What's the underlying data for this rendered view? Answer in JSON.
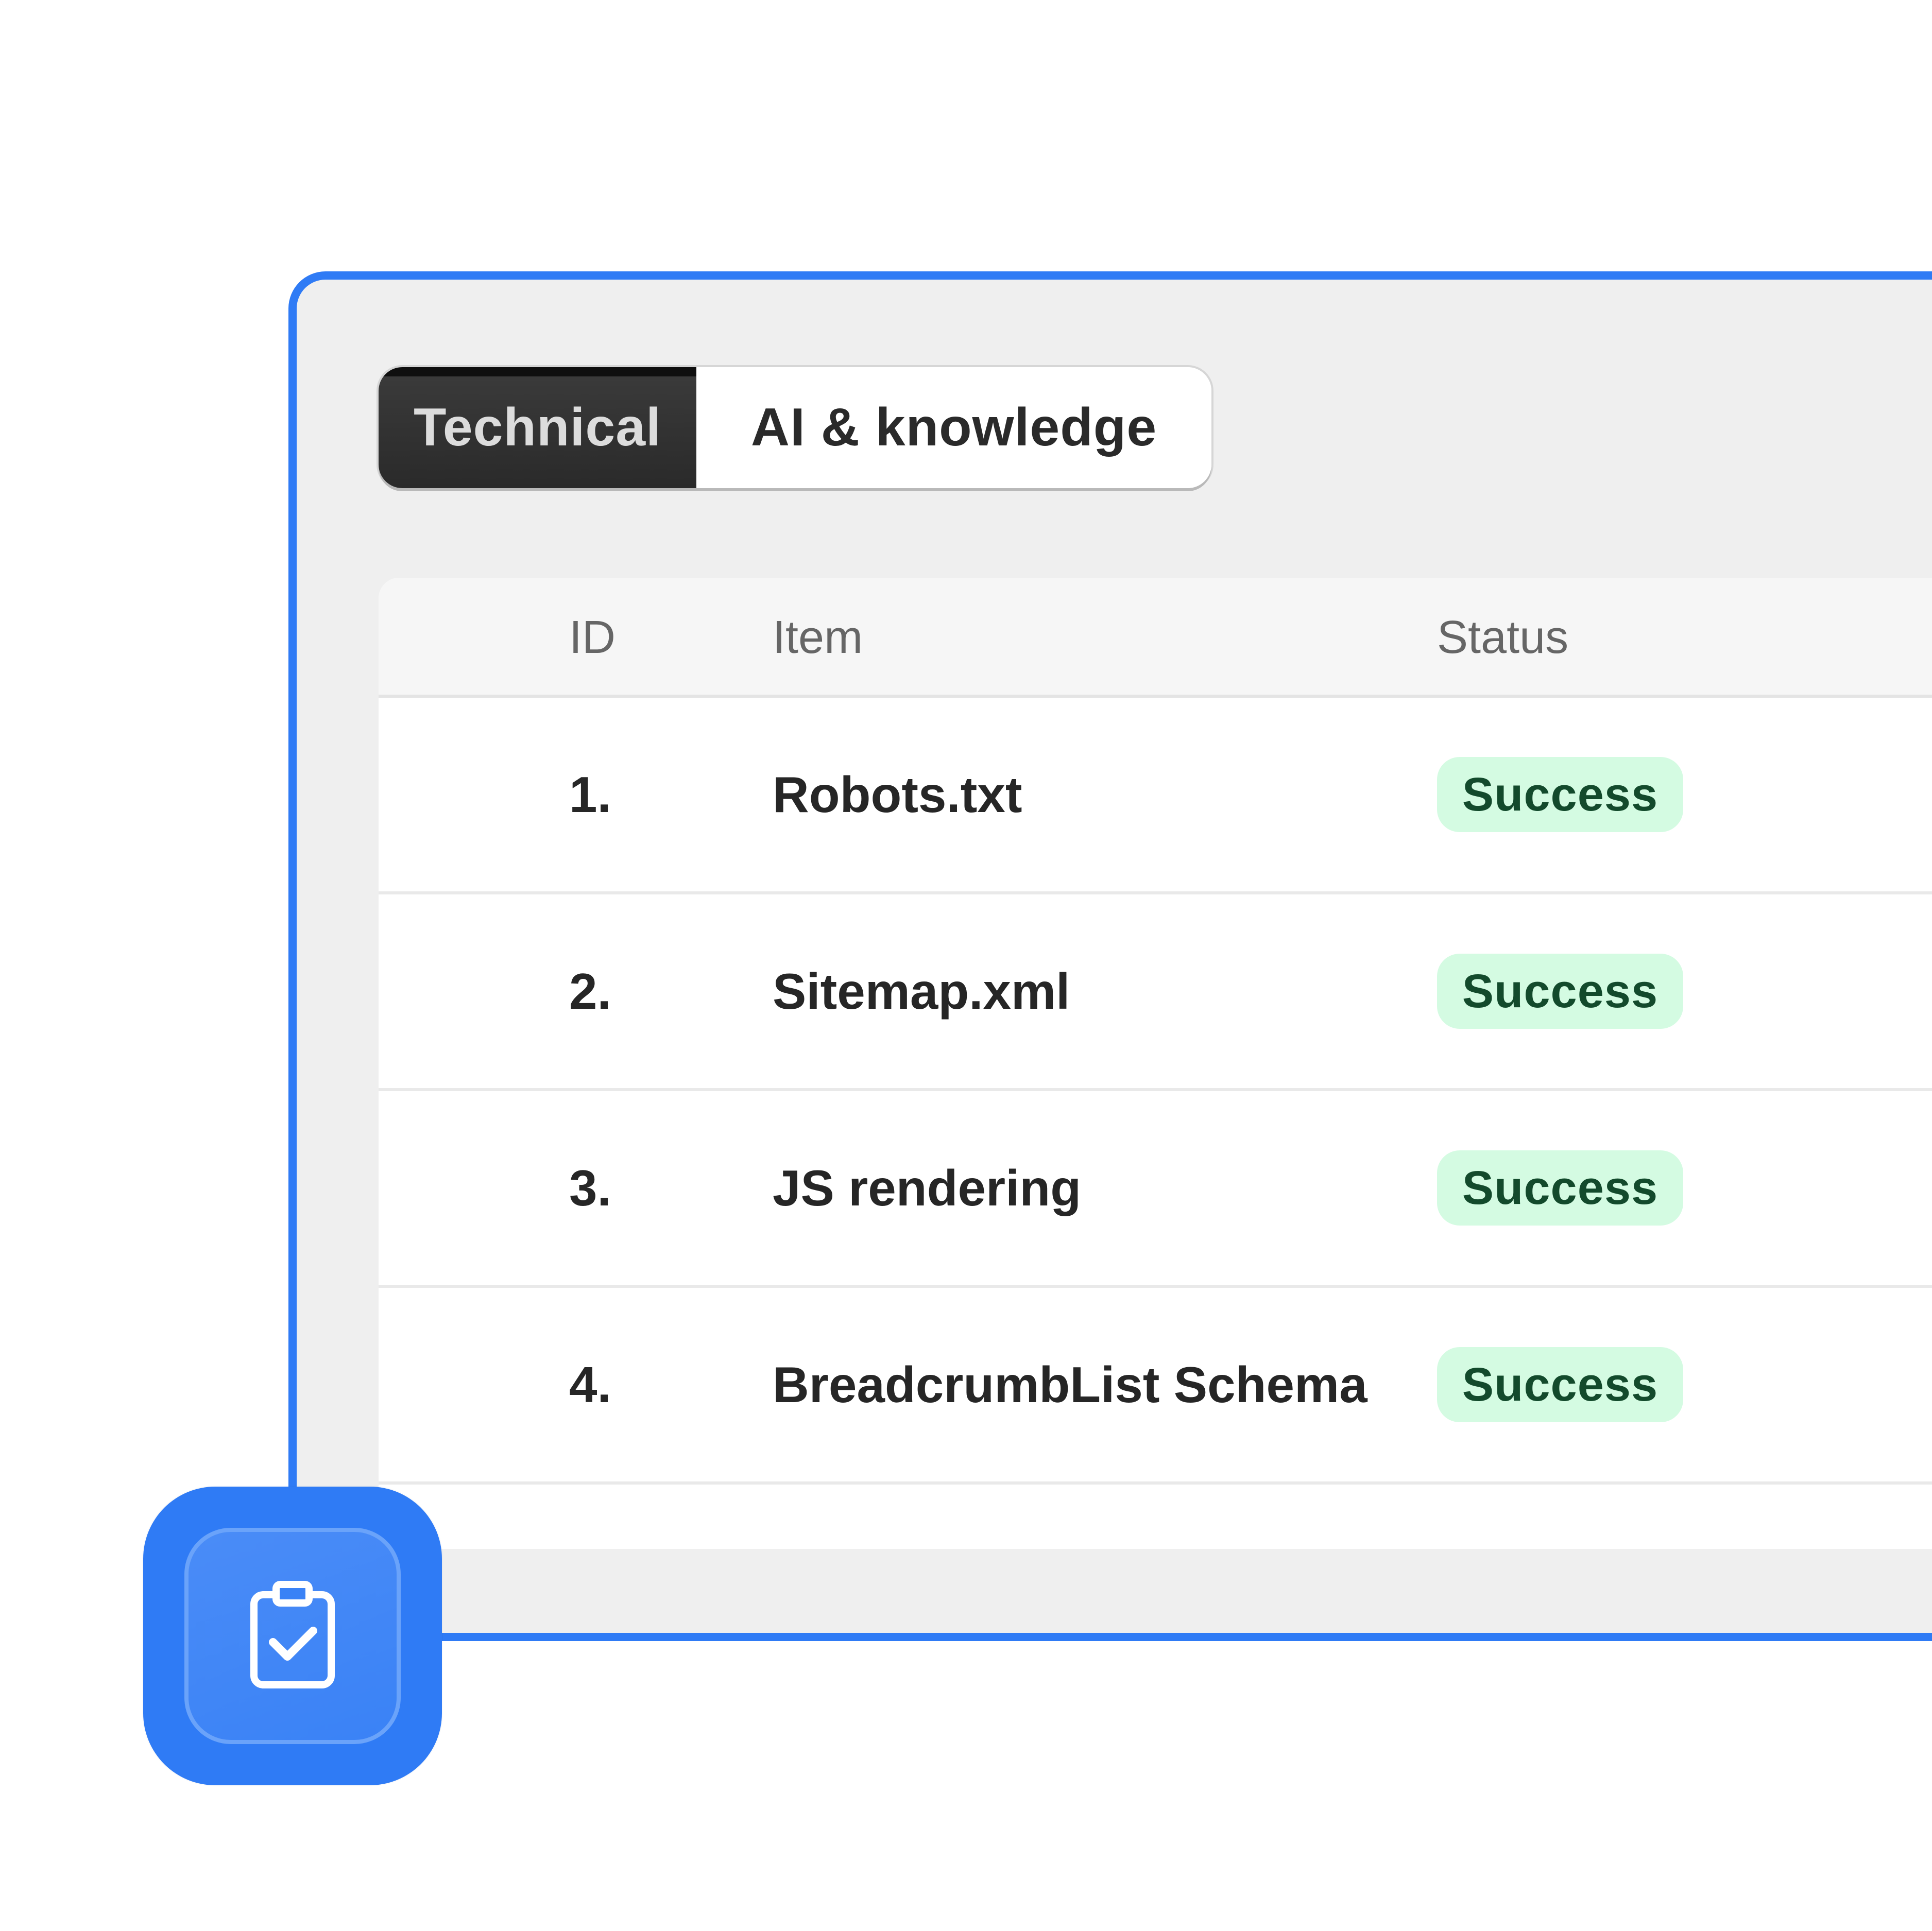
{
  "tabs": [
    {
      "label": "Technical",
      "active": true
    },
    {
      "label": "AI & knowledge",
      "active": false
    }
  ],
  "table": {
    "headers": {
      "id": "ID",
      "item": "Item",
      "status": "Status"
    },
    "rows": [
      {
        "id": "1.",
        "item": "Robots.txt",
        "status": "Success"
      },
      {
        "id": "2.",
        "item": "Sitemap.xml",
        "status": "Success"
      },
      {
        "id": "3.",
        "item": "JS rendering",
        "status": "Success"
      },
      {
        "id": "4.",
        "item": "BreadcrumbList Schema",
        "status": "Success"
      }
    ]
  },
  "icon": {
    "name": "clipboard-check-icon"
  },
  "colors": {
    "accent": "#2f7bf5",
    "success_bg": "#d4fbe2",
    "success_text": "#134a2c",
    "active_tab_bg": "#2a2a2a"
  }
}
